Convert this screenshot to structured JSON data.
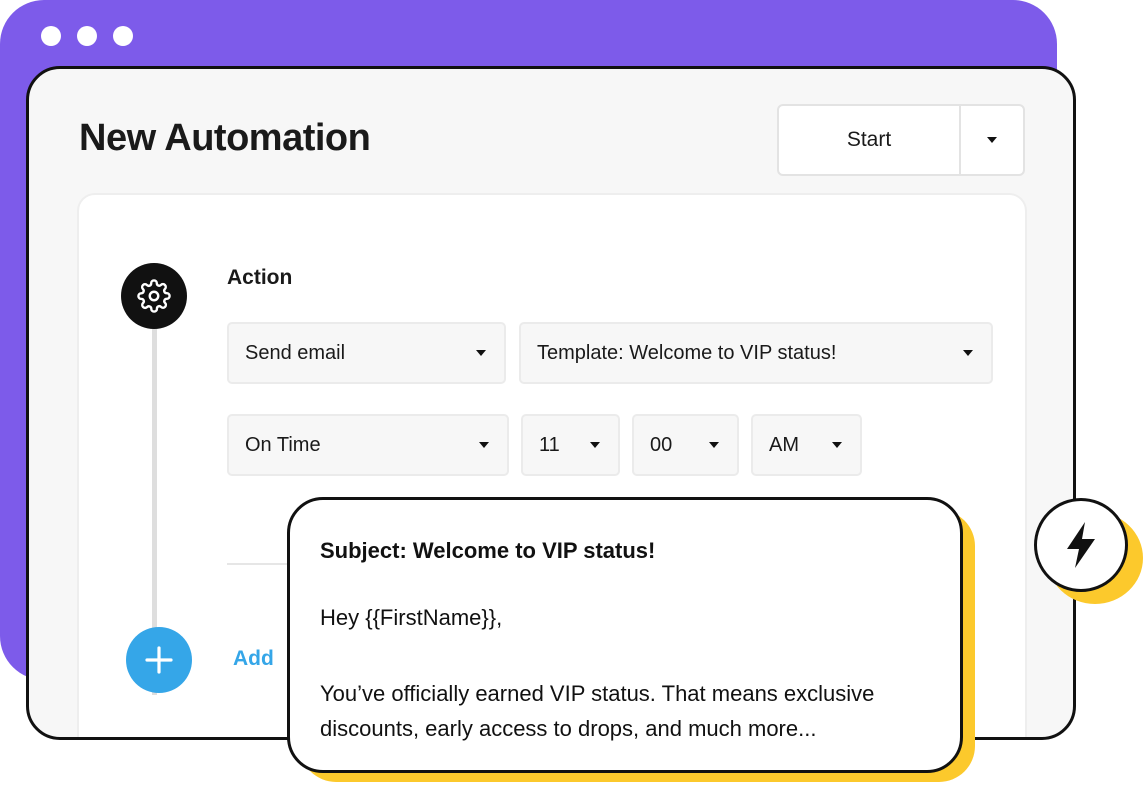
{
  "page": {
    "title": "New Automation"
  },
  "toolbar": {
    "start_label": "Start",
    "start_menu_icon": "caret-down-icon"
  },
  "workflow": {
    "step_icon": "gear-icon",
    "step_label": "Action",
    "action_select": {
      "value": "Send email"
    },
    "template_select": {
      "value": "Template: Welcome to VIP status!"
    },
    "timing_select": {
      "value": "On Time"
    },
    "hour_select": {
      "value": "11"
    },
    "minute_select": {
      "value": "00"
    },
    "ampm_select": {
      "value": "AM"
    },
    "add_icon": "plus-icon",
    "add_label": "Add"
  },
  "email_preview": {
    "subject": "Subject: Welcome to VIP status!",
    "greeting": "Hey {{FirstName}},",
    "body": "You’ve officially earned VIP status. That means exclusive discounts, early access to drops, and much more..."
  },
  "badge": {
    "icon": "lightning-bolt-icon"
  },
  "colors": {
    "brand_purple": "#7d5bea",
    "accent_blue": "#35a6e8",
    "accent_yellow": "#fcc92c",
    "outline": "#111111"
  }
}
